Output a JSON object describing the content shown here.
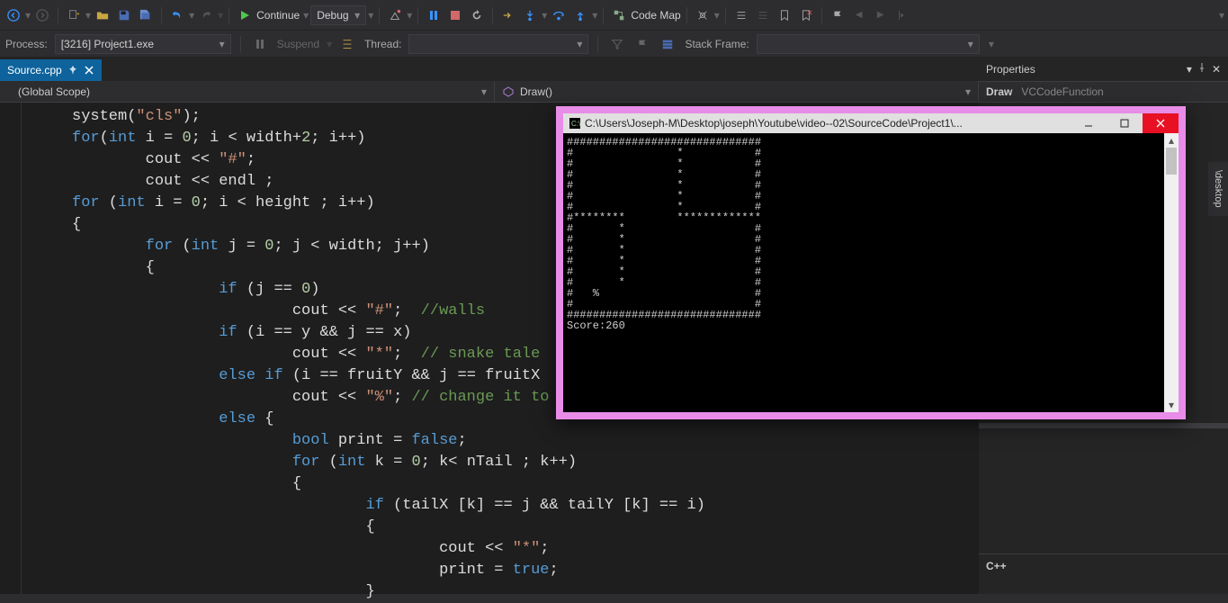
{
  "toolbar": {
    "continue_label": "Continue",
    "config_label": "Debug",
    "codemap_label": "Code Map"
  },
  "toolbar2": {
    "process_label": "Process:",
    "process_value": "[3216] Project1.exe",
    "suspend_label": "Suspend",
    "thread_label": "Thread:",
    "stackframe_label": "Stack Frame:"
  },
  "tabs": {
    "file": "Source.cpp"
  },
  "scope": {
    "left": "(Global Scope)",
    "right": "Draw()"
  },
  "properties": {
    "header": "Properties",
    "name": "Draw",
    "type": "VCCodeFunction",
    "footer": "C++",
    "sidetab": "\\desktop"
  },
  "console": {
    "title": "C:\\Users\\Joseph-M\\Desktop\\joseph\\Youtube\\video--02\\SourceCode\\Project1\\...",
    "score_line": "Score:260",
    "lines": [
      "##############################",
      "#                *           #",
      "#                *           #",
      "#                *           #",
      "#                *           #",
      "#                *           #",
      "#                *           #",
      "#********        *************",
      "#       *                    #",
      "#       *                    #",
      "#       *                    #",
      "#       *                    #",
      "#       *                    #",
      "#       *                    #",
      "#   %                        #",
      "#                            #",
      "##############################"
    ]
  },
  "code": {
    "lines": [
      {
        "indent": 0,
        "tokens": [
          {
            "t": "system(",
            "c": ""
          },
          {
            "t": "\"cls\"",
            "c": "str"
          },
          {
            "t": ");",
            "c": ""
          }
        ]
      },
      {
        "indent": 0,
        "tokens": [
          {
            "t": "for",
            "c": "kblue"
          },
          {
            "t": "(",
            "c": ""
          },
          {
            "t": "int",
            "c": "kblue"
          },
          {
            "t": " i = ",
            "c": ""
          },
          {
            "t": "0",
            "c": "num"
          },
          {
            "t": "; i < width+",
            "c": ""
          },
          {
            "t": "2",
            "c": "num"
          },
          {
            "t": "; i++)",
            "c": ""
          }
        ]
      },
      {
        "indent": 2,
        "tokens": [
          {
            "t": "cout << ",
            "c": ""
          },
          {
            "t": "\"#\"",
            "c": "str"
          },
          {
            "t": ";",
            "c": ""
          }
        ]
      },
      {
        "indent": 2,
        "tokens": [
          {
            "t": "cout << endl ;",
            "c": ""
          }
        ]
      },
      {
        "indent": 0,
        "tokens": [
          {
            "t": "for",
            "c": "kblue"
          },
          {
            "t": " (",
            "c": ""
          },
          {
            "t": "int",
            "c": "kblue"
          },
          {
            "t": " i = ",
            "c": ""
          },
          {
            "t": "0",
            "c": "num"
          },
          {
            "t": "; i < height ; i++)",
            "c": ""
          }
        ]
      },
      {
        "indent": 0,
        "tokens": [
          {
            "t": "{",
            "c": ""
          }
        ]
      },
      {
        "indent": 2,
        "tokens": [
          {
            "t": "for",
            "c": "kblue"
          },
          {
            "t": " (",
            "c": ""
          },
          {
            "t": "int",
            "c": "kblue"
          },
          {
            "t": " j = ",
            "c": ""
          },
          {
            "t": "0",
            "c": "num"
          },
          {
            "t": "; j < width; j++)",
            "c": ""
          }
        ]
      },
      {
        "indent": 2,
        "tokens": [
          {
            "t": "{",
            "c": ""
          }
        ]
      },
      {
        "indent": 4,
        "tokens": [
          {
            "t": "if",
            "c": "kblue"
          },
          {
            "t": " (j == ",
            "c": ""
          },
          {
            "t": "0",
            "c": "num"
          },
          {
            "t": ")",
            "c": ""
          }
        ]
      },
      {
        "indent": 6,
        "tokens": [
          {
            "t": "cout << ",
            "c": ""
          },
          {
            "t": "\"#\"",
            "c": "str"
          },
          {
            "t": ";  ",
            "c": ""
          },
          {
            "t": "//walls",
            "c": "cmt"
          }
        ]
      },
      {
        "indent": 4,
        "tokens": [
          {
            "t": "if",
            "c": "kblue"
          },
          {
            "t": " (i == y && j == x)",
            "c": ""
          }
        ]
      },
      {
        "indent": 6,
        "tokens": [
          {
            "t": "cout << ",
            "c": ""
          },
          {
            "t": "\"*\"",
            "c": "str"
          },
          {
            "t": ";  ",
            "c": ""
          },
          {
            "t": "// snake tale",
            "c": "cmt"
          }
        ]
      },
      {
        "indent": 4,
        "tokens": [
          {
            "t": "else if",
            "c": "kblue"
          },
          {
            "t": " (i == fruitY && j == fruitX  )",
            "c": ""
          }
        ]
      },
      {
        "indent": 6,
        "tokens": [
          {
            "t": "cout << ",
            "c": ""
          },
          {
            "t": "\"%\"",
            "c": "str"
          },
          {
            "t": "; ",
            "c": ""
          },
          {
            "t": "// change it to change the",
            "c": "cmt"
          }
        ]
      },
      {
        "indent": 4,
        "tokens": [
          {
            "t": "else",
            "c": "kblue"
          },
          {
            "t": " {",
            "c": ""
          }
        ]
      },
      {
        "indent": 6,
        "tokens": [
          {
            "t": "bool",
            "c": "kblue"
          },
          {
            "t": " print = ",
            "c": ""
          },
          {
            "t": "false",
            "c": "kblue"
          },
          {
            "t": ";",
            "c": ""
          }
        ]
      },
      {
        "indent": 6,
        "tokens": [
          {
            "t": "for",
            "c": "kblue"
          },
          {
            "t": " (",
            "c": ""
          },
          {
            "t": "int",
            "c": "kblue"
          },
          {
            "t": " k = ",
            "c": ""
          },
          {
            "t": "0",
            "c": "num"
          },
          {
            "t": "; k< nTail ; k++)",
            "c": ""
          }
        ]
      },
      {
        "indent": 6,
        "tokens": [
          {
            "t": "{",
            "c": ""
          }
        ]
      },
      {
        "indent": 8,
        "tokens": [
          {
            "t": "if",
            "c": "kblue"
          },
          {
            "t": " (tailX [k] == j && tailY [k] == i)",
            "c": ""
          }
        ]
      },
      {
        "indent": 8,
        "tokens": [
          {
            "t": "{",
            "c": ""
          }
        ]
      },
      {
        "indent": 10,
        "tokens": [
          {
            "t": "cout << ",
            "c": ""
          },
          {
            "t": "\"*\"",
            "c": "str"
          },
          {
            "t": ";",
            "c": ""
          }
        ]
      },
      {
        "indent": 10,
        "tokens": [
          {
            "t": "print = ",
            "c": ""
          },
          {
            "t": "true",
            "c": "kblue"
          },
          {
            "t": ";",
            "c": ""
          }
        ]
      },
      {
        "indent": 8,
        "tokens": [
          {
            "t": "}",
            "c": ""
          }
        ]
      }
    ]
  }
}
